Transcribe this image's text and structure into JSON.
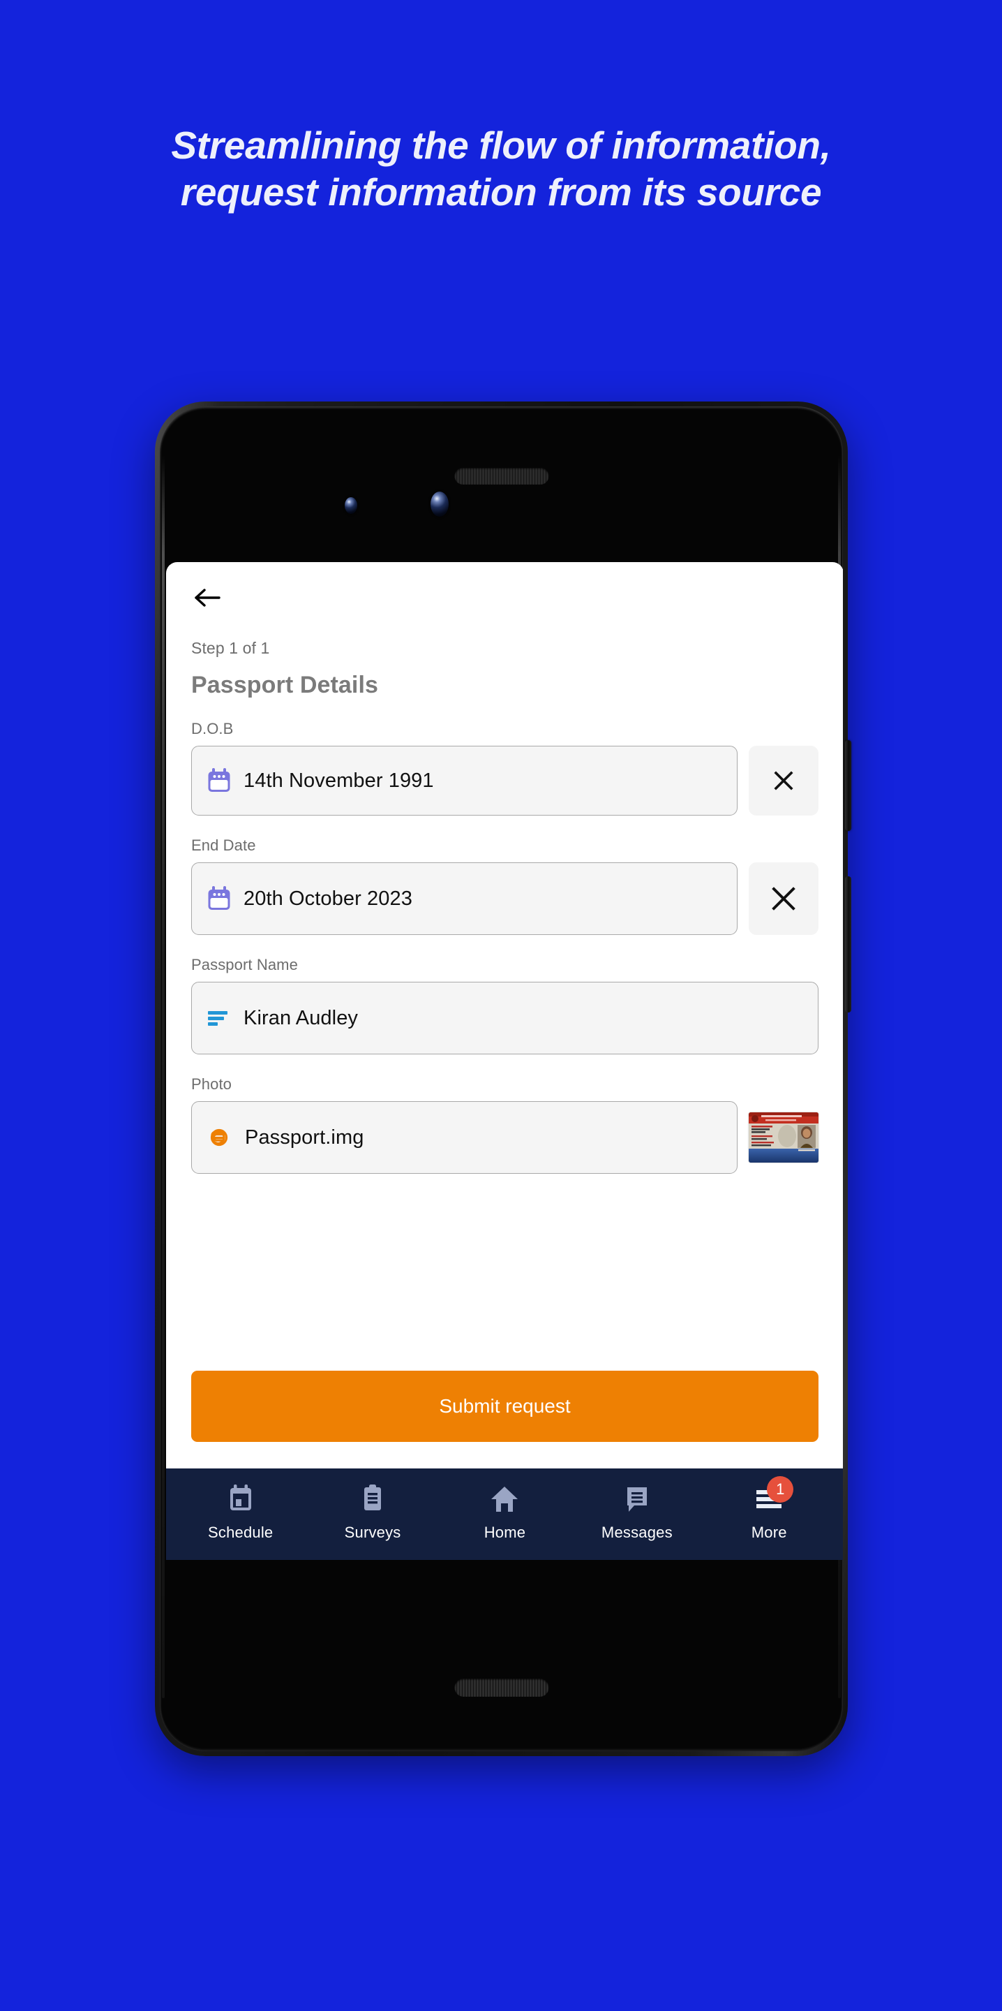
{
  "headline": {
    "line1": "Streamlining the flow of information,",
    "line2": "request information from its source"
  },
  "colors": {
    "background_blue": "#1423DC",
    "accent_orange": "#EE8003",
    "nav_navy": "#131F3E",
    "badge_red": "#E6503C",
    "calendar_icon_purple": "#7A76DE",
    "name_icon_blue": "#2196D6",
    "attach_icon_orange": "#EE8003"
  },
  "app": {
    "back_icon": "arrow-left-icon",
    "step_label": "Step 1 of 1",
    "title": "Passport Details",
    "fields": [
      {
        "label": "D.O.B",
        "value": "14th November 1991",
        "icon": "calendar-icon",
        "has_clear": true,
        "clear_icon": "close-icon",
        "has_thumb": false
      },
      {
        "label": "End Date",
        "value": "20th October 2023",
        "icon": "calendar-icon",
        "has_clear": true,
        "clear_icon": "close-icon",
        "has_thumb": false
      },
      {
        "label": "Passport Name",
        "value": "Kiran Audley",
        "icon": "text-lines-icon",
        "has_clear": false,
        "has_thumb": false
      },
      {
        "label": "Photo",
        "value": "Passport.img",
        "icon": "paperclip-icon",
        "has_clear": false,
        "has_thumb": true,
        "thumb_name": "id-card-thumbnail"
      }
    ],
    "submit_label": "Submit request",
    "bottom_nav": [
      {
        "label": "Schedule",
        "icon": "calendar-icon",
        "badge": ""
      },
      {
        "label": "Surveys",
        "icon": "clipboard-icon",
        "badge": ""
      },
      {
        "label": "Home",
        "icon": "home-icon",
        "badge": ""
      },
      {
        "label": "Messages",
        "icon": "chat-icon",
        "badge": ""
      },
      {
        "label": "More",
        "icon": "menu-icon",
        "badge": "1"
      }
    ]
  }
}
